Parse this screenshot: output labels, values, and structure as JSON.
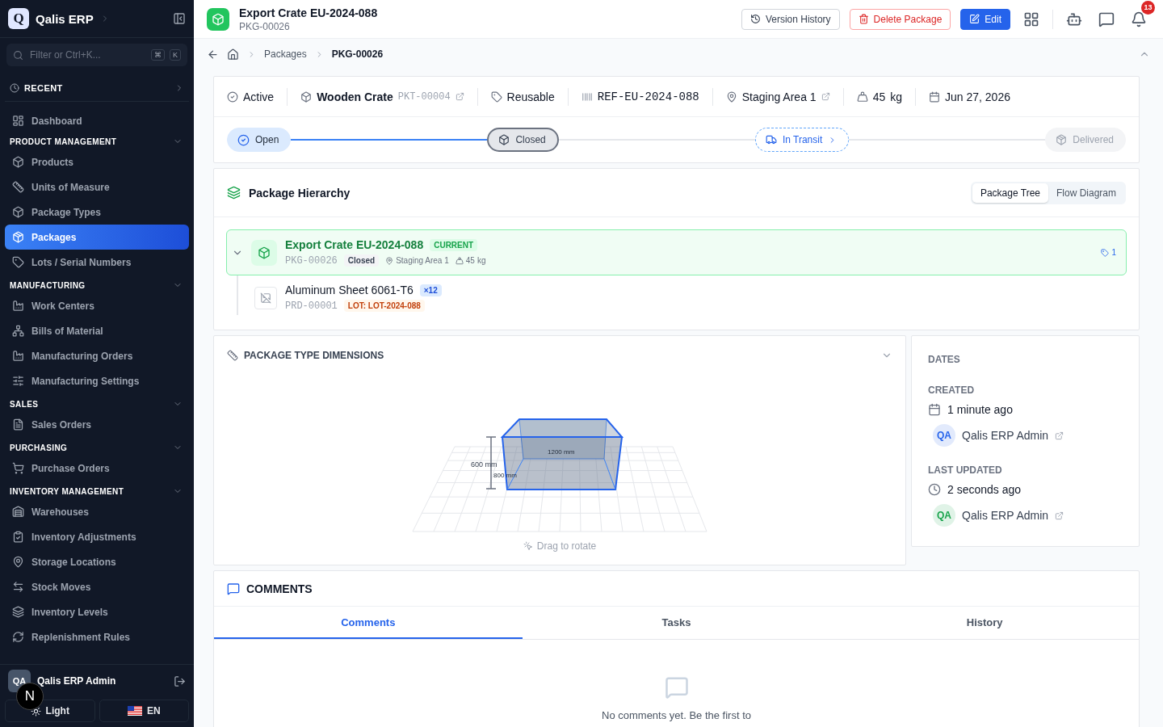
{
  "sidebar": {
    "brand": "Qalis ERP",
    "logo": "Q",
    "search": {
      "placeholder": "Filter or Ctrl+K...",
      "keys": [
        "⌘",
        "K"
      ]
    },
    "recent": "RECENT",
    "nav": [
      {
        "kind": "link",
        "label": "Dashboard",
        "selected": false
      },
      {
        "kind": "section",
        "label": "PRODUCT MANAGEMENT",
        "expanded": true,
        "items": [
          {
            "label": "Products",
            "selected": false
          },
          {
            "label": "Units of Measure",
            "selected": false
          },
          {
            "label": "Package Types",
            "selected": false
          },
          {
            "label": "Packages",
            "selected": true
          },
          {
            "label": "Lots / Serial Numbers",
            "selected": false
          }
        ]
      },
      {
        "kind": "section",
        "label": "MANUFACTURING",
        "expanded": true,
        "items": [
          {
            "label": "Work Centers",
            "selected": false
          },
          {
            "label": "Bills of Material",
            "selected": false
          },
          {
            "label": "Manufacturing Orders",
            "selected": false
          },
          {
            "label": "Manufacturing Settings",
            "selected": false
          }
        ]
      },
      {
        "kind": "section",
        "label": "SALES",
        "expanded": true,
        "items": [
          {
            "label": "Sales Orders",
            "selected": false
          }
        ]
      },
      {
        "kind": "section",
        "label": "PURCHASING",
        "expanded": true,
        "items": [
          {
            "label": "Purchase Orders",
            "selected": false
          }
        ]
      },
      {
        "kind": "section",
        "label": "INVENTORY MANAGEMENT",
        "expanded": true,
        "items": [
          {
            "label": "Warehouses",
            "selected": false
          },
          {
            "label": "Inventory Adjustments",
            "selected": false
          },
          {
            "label": "Storage Locations",
            "selected": false
          },
          {
            "label": "Stock Moves",
            "selected": false
          },
          {
            "label": "Inventory Levels",
            "selected": false
          },
          {
            "label": "Replenishment Rules",
            "selected": false
          }
        ]
      }
    ],
    "user": {
      "initials": "QA",
      "name": "Qalis ERP Admin"
    },
    "theme_button": "Light",
    "language_button": "EN",
    "dev_badge": "N"
  },
  "header": {
    "title": "Export Crate EU-2024-088",
    "code": "PKG-00026",
    "buttons": [
      {
        "kind": "outline",
        "label": "Version History"
      },
      {
        "kind": "danger",
        "label": "Delete Package"
      },
      {
        "kind": "primary",
        "label": "Edit"
      }
    ],
    "notification_count": "13"
  },
  "breadcrumb": [
    "Packages",
    "PKG-00026"
  ],
  "info_bar": [
    {
      "kind": "status",
      "label": "Active"
    },
    {
      "kind": "type",
      "label": "Wooden Crate",
      "code": "PKT-00004"
    },
    {
      "kind": "tag",
      "label": "Reusable"
    },
    {
      "kind": "reference",
      "label": "REF-EU-2024-088"
    },
    {
      "kind": "location",
      "label": "Staging Area 1"
    },
    {
      "kind": "weight",
      "label": "45",
      "unit": "kg"
    },
    {
      "kind": "date",
      "label": "Jun 27, 2026"
    }
  ],
  "stepper": [
    {
      "label": "Open",
      "done": true,
      "selected": false,
      "disabled": false
    },
    {
      "label": "Closed",
      "done": false,
      "selected": true,
      "disabled": false
    },
    {
      "label": "In Transit",
      "done": false,
      "selected": false,
      "disabled": false
    },
    {
      "label": "Delivered",
      "done": false,
      "selected": false,
      "disabled": true
    }
  ],
  "hierarchy": {
    "title": "Package Hierarchy",
    "views": [
      {
        "label": "Package Tree",
        "selected": true
      },
      {
        "label": "Flow Diagram",
        "selected": false
      }
    ],
    "root": {
      "expanded": true,
      "name": "Export Crate EU-2024-088",
      "badge": "CURRENT",
      "code": "PKG-00026",
      "status": "Closed",
      "location": "Staging Area 1",
      "weight": "45",
      "unit": "kg",
      "count": "1",
      "children": [
        {
          "name": "Aluminum Sheet 6061-T6",
          "quantity": "×12",
          "code": "PRD-00001",
          "lot": "LOT: LOT-2024-088"
        }
      ]
    }
  },
  "dimensions": {
    "title": "PACKAGE TYPE DIMENSIONS",
    "expanded": true,
    "height_label": "600 mm",
    "depth_label": "800 mm",
    "width_label": "1200 mm",
    "hint": "Drag to rotate"
  },
  "dates": {
    "title": "DATES",
    "entries": [
      {
        "kind": "created",
        "label": "CREATED",
        "time": "1 minute ago",
        "initials": "QA",
        "user": "Qalis ERP Admin",
        "color": "#2563eb"
      },
      {
        "kind": "updated",
        "label": "LAST UPDATED",
        "time": "2 seconds ago",
        "initials": "QA",
        "user": "Qalis ERP Admin",
        "color": "#16a34a"
      }
    ]
  },
  "comments": {
    "title": "COMMENTS",
    "tabs": [
      {
        "label": "Comments",
        "selected": true
      },
      {
        "label": "Tasks",
        "selected": false
      },
      {
        "label": "History",
        "selected": false
      }
    ],
    "empty": "No comments yet. Be the first to"
  }
}
